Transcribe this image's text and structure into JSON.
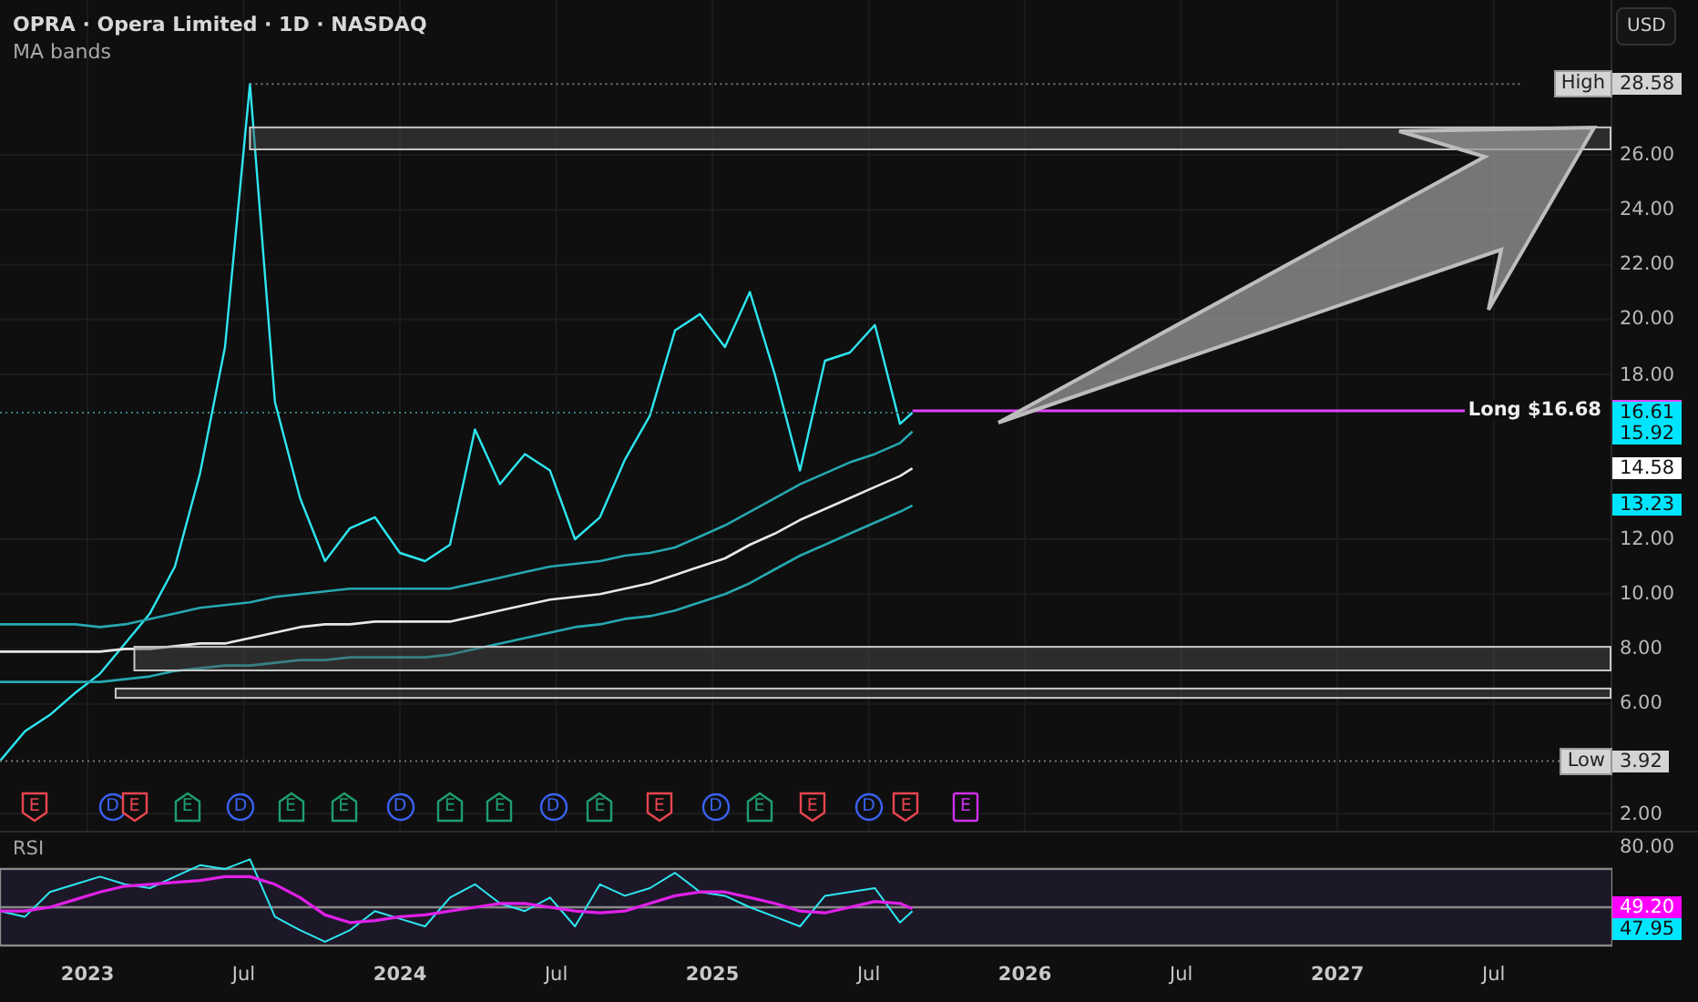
{
  "header": {
    "symbol_title": "OPRA · Opera Limited · 1D · NASDAQ",
    "indicator": "MA bands"
  },
  "currency_button": "USD",
  "main_chart": {
    "chart_data": {
      "type": "line",
      "xlim": [
        2022.72,
        2027.88
      ],
      "ylim": [
        1.38,
        31.64
      ],
      "grid": true,
      "x": [
        2022.72,
        2022.8,
        2022.88,
        2022.96,
        2023.04,
        2023.12,
        2023.2,
        2023.28,
        2023.36,
        2023.44,
        2023.52,
        2023.6,
        2023.68,
        2023.76,
        2023.84,
        2023.92,
        2024.0,
        2024.08,
        2024.16,
        2024.24,
        2024.32,
        2024.4,
        2024.48,
        2024.56,
        2024.64,
        2024.72,
        2024.8,
        2024.88,
        2024.96,
        2025.04,
        2025.12,
        2025.2,
        2025.28,
        2025.36,
        2025.44,
        2025.52,
        2025.6,
        2025.64
      ],
      "series": [
        {
          "color": "#2ee6f0",
          "values": [
            3.92,
            5.0,
            5.6,
            6.4,
            7.1,
            8.2,
            9.3,
            11.0,
            14.4,
            19.0,
            28.58,
            17.0,
            13.5,
            11.2,
            12.4,
            12.8,
            11.5,
            11.2,
            11.8,
            16.0,
            14.0,
            15.1,
            14.5,
            12.0,
            12.8,
            14.9,
            16.5,
            19.6,
            20.2,
            19.0,
            21.0,
            18.0,
            14.5,
            18.5,
            18.8,
            19.8,
            16.2,
            16.61
          ]
        },
        {
          "color": "#26a8b0",
          "values": [
            8.9,
            8.9,
            8.9,
            8.9,
            8.8,
            8.9,
            9.1,
            9.3,
            9.5,
            9.6,
            9.7,
            9.9,
            10.0,
            10.1,
            10.2,
            10.2,
            10.2,
            10.2,
            10.2,
            10.4,
            10.6,
            10.8,
            11.0,
            11.1,
            11.2,
            11.4,
            11.5,
            11.7,
            12.1,
            12.5,
            13.0,
            13.5,
            14.0,
            14.4,
            14.8,
            15.1,
            15.5,
            15.92
          ]
        },
        {
          "color": "#e8e8e8",
          "values": [
            7.9,
            7.9,
            7.9,
            7.9,
            7.9,
            8.0,
            8.0,
            8.1,
            8.2,
            8.2,
            8.4,
            8.6,
            8.8,
            8.9,
            8.9,
            9.0,
            9.0,
            9.0,
            9.0,
            9.2,
            9.4,
            9.6,
            9.8,
            9.9,
            10.0,
            10.2,
            10.4,
            10.7,
            11.0,
            11.3,
            11.8,
            12.2,
            12.7,
            13.1,
            13.5,
            13.9,
            14.3,
            14.58
          ]
        },
        {
          "color": "#26a8b0",
          "values": [
            6.8,
            6.8,
            6.8,
            6.8,
            6.8,
            6.9,
            7.0,
            7.2,
            7.3,
            7.4,
            7.4,
            7.5,
            7.6,
            7.6,
            7.7,
            7.7,
            7.7,
            7.7,
            7.8,
            8.0,
            8.2,
            8.4,
            8.6,
            8.8,
            8.9,
            9.1,
            9.2,
            9.4,
            9.7,
            10.0,
            10.4,
            10.9,
            11.4,
            11.8,
            12.2,
            12.6,
            13.0,
            13.23
          ]
        }
      ],
      "xticks": [
        {
          "value": 2023,
          "label": "2023"
        },
        {
          "value": 2023.5,
          "label": "Jul"
        },
        {
          "value": 2024,
          "label": "2024"
        },
        {
          "value": 2024.5,
          "label": "Jul"
        },
        {
          "value": 2025,
          "label": "2025"
        },
        {
          "value": 2025.5,
          "label": "Jul"
        },
        {
          "value": 2026,
          "label": "2026"
        },
        {
          "value": 2026.5,
          "label": "Jul"
        },
        {
          "value": 2027,
          "label": "2027"
        },
        {
          "value": 2027.5,
          "label": "Jul"
        }
      ],
      "yticks": [
        {
          "value": 2,
          "label": "2.00"
        },
        {
          "value": 6,
          "label": "6.00"
        },
        {
          "value": 8,
          "label": "8.00"
        },
        {
          "value": 10,
          "label": "10.00"
        },
        {
          "value": 12,
          "label": "12.00"
        },
        {
          "value": 18,
          "label": "18.00"
        },
        {
          "value": 20,
          "label": "20.00"
        },
        {
          "value": 22,
          "label": "22.00"
        },
        {
          "value": 24,
          "label": "24.00"
        },
        {
          "value": 26,
          "label": "26.00"
        }
      ],
      "annotations": [
        {
          "text": "E",
          "x": 2022.83,
          "y": 2.25
        },
        {
          "text": "D",
          "x": 2023.08,
          "y": 2.25
        },
        {
          "text": "E",
          "x": 2023.15,
          "y": 2.25
        },
        {
          "text": "E",
          "x": 2023.32,
          "y": 2.25
        },
        {
          "text": "D",
          "x": 2023.49,
          "y": 2.25
        },
        {
          "text": "E",
          "x": 2023.65,
          "y": 2.25
        },
        {
          "text": "E",
          "x": 2023.82,
          "y": 2.25
        },
        {
          "text": "D",
          "x": 2024.0,
          "y": 2.25
        },
        {
          "text": "E",
          "x": 2024.16,
          "y": 2.25
        },
        {
          "text": "E",
          "x": 2024.32,
          "y": 2.25
        },
        {
          "text": "D",
          "x": 2024.49,
          "y": 2.25
        },
        {
          "text": "E",
          "x": 2024.64,
          "y": 2.25
        },
        {
          "text": "E",
          "x": 2024.83,
          "y": 2.25
        },
        {
          "text": "D",
          "x": 2025.01,
          "y": 2.25
        },
        {
          "text": "E",
          "x": 2025.15,
          "y": 2.25
        },
        {
          "text": "E",
          "x": 2025.32,
          "y": 2.25
        },
        {
          "text": "D",
          "x": 2025.5,
          "y": 2.25
        },
        {
          "text": "E",
          "x": 2025.62,
          "y": 2.25
        },
        {
          "text": "E",
          "x": 2025.81,
          "y": 2.25
        }
      ]
    },
    "axis_labels": [
      {
        "text": "16.61",
        "color": "#00e5ff"
      },
      {
        "text": "15.92",
        "color": "#00e5ff"
      },
      {
        "text": "14.58",
        "color": "#ffffff"
      },
      {
        "text": "13.23",
        "color": "#00e5ff"
      }
    ],
    "extremes": [
      {
        "kind": "high",
        "label": "High",
        "value": "28.58"
      },
      {
        "kind": "low",
        "label": "Low",
        "value": "3.92"
      }
    ],
    "position": {
      "label": "Long $16.68"
    }
  },
  "events": [
    {
      "kind": "earnings_miss",
      "color": "#e8454f"
    },
    {
      "kind": "dividend",
      "color": "#3a62f0"
    },
    {
      "kind": "earnings_miss",
      "color": "#e8454f"
    },
    {
      "kind": "earnings_beat",
      "color": "#1e9e6e"
    },
    {
      "kind": "dividend",
      "color": "#3a62f0"
    },
    {
      "kind": "earnings_beat",
      "color": "#1e9e6e"
    },
    {
      "kind": "earnings_beat",
      "color": "#1e9e6e"
    },
    {
      "kind": "dividend",
      "color": "#3a62f0"
    },
    {
      "kind": "earnings_beat",
      "color": "#1e9e6e"
    },
    {
      "kind": "earnings_beat",
      "color": "#1e9e6e"
    },
    {
      "kind": "dividend",
      "color": "#3a62f0"
    },
    {
      "kind": "earnings_beat",
      "color": "#1e9e6e"
    },
    {
      "kind": "earnings_miss",
      "color": "#e8454f"
    },
    {
      "kind": "dividend",
      "color": "#3a62f0"
    },
    {
      "kind": "earnings_beat",
      "color": "#1e9e6e"
    },
    {
      "kind": "earnings_miss",
      "color": "#e8454f"
    },
    {
      "kind": "dividend",
      "color": "#3a62f0"
    },
    {
      "kind": "earnings_miss",
      "color": "#e8454f"
    },
    {
      "kind": "earnings_upcoming",
      "color": "#d030f0"
    }
  ],
  "rsi_pane": {
    "title": "RSI",
    "scale_label": "80.00",
    "axis_labels": [
      {
        "text": "49.20",
        "color": "#ff00ff"
      },
      {
        "text": "47.95",
        "color": "#00e5ff"
      }
    ]
  }
}
